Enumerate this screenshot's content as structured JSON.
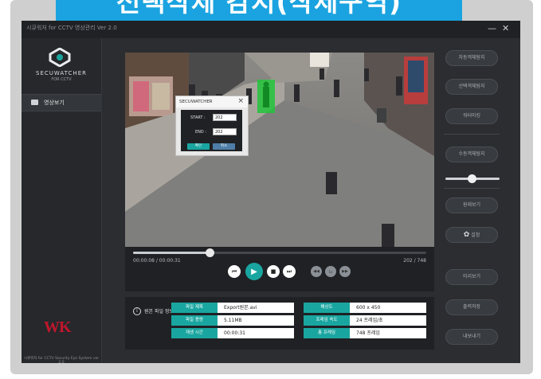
{
  "banner": {
    "title": "선택삭제 감지(삭제구역)"
  },
  "window": {
    "title": "시큐워처 for CCTV 영상관리 Ver 2.0",
    "minimize": "—",
    "close": "✕"
  },
  "sidebar": {
    "brand": "SECUWATCHER",
    "brand_sub": "FOR CCTV",
    "menu": [
      {
        "label": "영상보기",
        "icon": "video-icon"
      }
    ],
    "company": "WK",
    "footer": "시큐워처 for CCTV Security Eye System ver 2.0"
  },
  "dialog": {
    "title": "SECUWATCHER",
    "start_label": "START :",
    "start_value": "202",
    "end_label": "END :",
    "end_value": "202",
    "confirm": "확인",
    "cancel": "취소"
  },
  "player": {
    "time": "00:00:08 / 00:00:31",
    "frames": "202 / 748",
    "progress": 0.26,
    "colors": {
      "accent": "#1aa6a0",
      "detect": "#22c33a"
    }
  },
  "file_info": {
    "title": "원본 파일 정보",
    "rows": [
      {
        "k1": "파일 제목",
        "v1": "Export원본.avi",
        "k2": "해상도",
        "v2": "600 x 450"
      },
      {
        "k1": "파일 용량",
        "v1": "5.11MB",
        "k2": "프레임 속도",
        "v2": "24 프레임/초"
      },
      {
        "k1": "재생 시간",
        "v1": "00:00:31",
        "k2": "총 프레임",
        "v2": "748 프레임"
      }
    ]
  },
  "right_panel": {
    "buttons": [
      "자동객체탐지",
      "선택객체탐지",
      "워터마킹",
      "수동객체탐지",
      "원래보기",
      "설정",
      "미리보기",
      "출력저장",
      "내보내기"
    ],
    "slider_level": 0.5
  }
}
